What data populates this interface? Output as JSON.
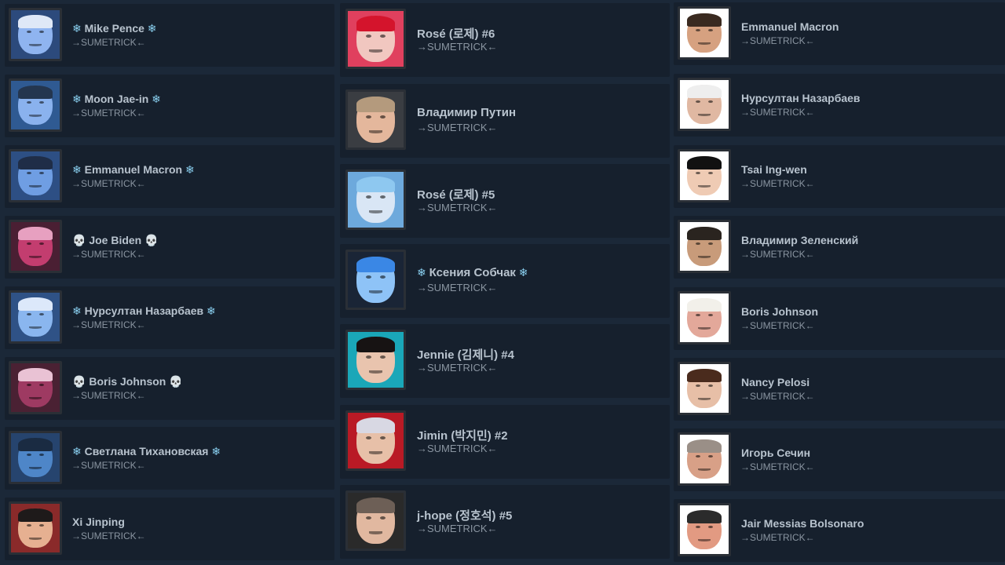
{
  "columns": [
    {
      "items": [
        {
          "name": "Mike Pence",
          "badge": "snowflake",
          "subtitle": "→SUMETRICK←",
          "skin": "#8fb4f0",
          "hair": "#dfe8f7",
          "bg": "#2c4a7c"
        },
        {
          "name": "Moon Jae-in",
          "badge": "snowflake",
          "subtitle": "→SUMETRICK←",
          "skin": "#8ab2ee",
          "hair": "#24364f",
          "bg": "#2f5a92"
        },
        {
          "name": "Emmanuel Macron",
          "badge": "snowflake",
          "subtitle": "→SUMETRICK←",
          "skin": "#6f9ee3",
          "hair": "#1f2d47",
          "bg": "#2d4f84"
        },
        {
          "name": "Joe Biden",
          "badge": "skull",
          "subtitle": "→SUMETRICK←",
          "skin": "#c33d6f",
          "hair": "#e7a0c0",
          "bg": "#4a1f33"
        },
        {
          "name": "Нурсултан Назарбаев",
          "badge": "snowflake",
          "subtitle": "→SUMETRICK←",
          "skin": "#8ab6ef",
          "hair": "#dce8fa",
          "bg": "#2f5286"
        },
        {
          "name": "Boris Johnson",
          "badge": "skull",
          "subtitle": "→SUMETRICK←",
          "skin": "#9e3a62",
          "hair": "#e9c2d4",
          "bg": "#4a2133"
        },
        {
          "name": "Светлана Тихановская",
          "badge": "snowflake",
          "subtitle": "→SUMETRICK←",
          "skin": "#4e86c8",
          "hair": "#1a2b42",
          "bg": "#26446e"
        },
        {
          "name": "Xi Jinping",
          "badge": "none",
          "subtitle": "→SUMETRICK←",
          "skin": "#e6b091",
          "hair": "#1e1a1a",
          "bg": "#8a2a2a"
        }
      ]
    },
    {
      "items": [
        {
          "name": "Rosé (로제) #6",
          "badge": "none",
          "subtitle": "→SUMETRICK←",
          "skin": "#f1c7c0",
          "hair": "#d4142c",
          "bg": "#e0405e"
        },
        {
          "name": "Владимир Путин",
          "badge": "none",
          "subtitle": "→SUMETRICK←",
          "skin": "#e4b79c",
          "hair": "#b49a7d",
          "bg": "#3a3d42"
        },
        {
          "name": "Rosé (로제) #5",
          "badge": "none",
          "subtitle": "→SUMETRICK←",
          "skin": "#d9e6f5",
          "hair": "#8ec8f0",
          "bg": "#6da9dc"
        },
        {
          "name": "Ксения Собчак",
          "badge": "snowflake",
          "subtitle": "→SUMETRICK←",
          "skin": "#8ec3f7",
          "hair": "#3a87e5",
          "bg": "#1a2536"
        },
        {
          "name": "Jennie (김제니) #4",
          "badge": "none",
          "subtitle": "→SUMETRICK←",
          "skin": "#e9c4ae",
          "hair": "#171313",
          "bg": "#1aa7b8"
        },
        {
          "name": "Jimin (박지민) #2",
          "badge": "none",
          "subtitle": "→SUMETRICK←",
          "skin": "#e7c0a8",
          "hair": "#d8d8e3",
          "bg": "#b91a25"
        },
        {
          "name": "j-hope (정호석) #5",
          "badge": "none",
          "subtitle": "→SUMETRICK←",
          "skin": "#e1b8a0",
          "hair": "#6d5f56",
          "bg": "#2a2a2a"
        }
      ]
    },
    {
      "items": [
        {
          "name": "Emmanuel Macron",
          "badge": "none",
          "subtitle": "→SUMETRICK←",
          "skin": "#d6a180",
          "hair": "#3a2a20",
          "bg": "#ffffff"
        },
        {
          "name": "Нурсултан Назарбаев",
          "badge": "none",
          "subtitle": "→SUMETRICK←",
          "skin": "#e0b8a2",
          "hair": "#eeeeee",
          "bg": "#ffffff"
        },
        {
          "name": "Tsai Ing-wen",
          "badge": "none",
          "subtitle": "→SUMETRICK←",
          "skin": "#efcbb4",
          "hair": "#111111",
          "bg": "#ffffff"
        },
        {
          "name": "Владимир Зеленский",
          "badge": "none",
          "subtitle": "→SUMETRICK←",
          "skin": "#c89b7a",
          "hair": "#2a241f",
          "bg": "#ffffff"
        },
        {
          "name": "Boris Johnson",
          "badge": "none",
          "subtitle": "→SUMETRICK←",
          "skin": "#e3a89a",
          "hair": "#f2f0ea",
          "bg": "#ffffff"
        },
        {
          "name": "Nancy Pelosi",
          "badge": "none",
          "subtitle": "→SUMETRICK←",
          "skin": "#e7bfa7",
          "hair": "#4a2b1d",
          "bg": "#ffffff"
        },
        {
          "name": "Игорь Сечин",
          "badge": "none",
          "subtitle": "→SUMETRICK←",
          "skin": "#d8a087",
          "hair": "#9a8f87",
          "bg": "#ffffff"
        },
        {
          "name": "Jair Messias Bolsonaro",
          "badge": "none",
          "subtitle": "→SUMETRICK←",
          "skin": "#e29a82",
          "hair": "#2b2b2b",
          "bg": "#ffffff"
        }
      ]
    }
  ],
  "badges": {
    "snowflake": {
      "glyph": "❄",
      "icon": "snowflake-icon",
      "color": "#8ad0f0"
    },
    "skull": {
      "glyph": "💀",
      "icon": "skull-icon",
      "color": "#e6e6e6"
    }
  },
  "colors": {
    "page_background": "#1b2838",
    "card_background": "#16202d",
    "name_text": "#b8c3ce",
    "subtitle_text": "#8a95a1"
  }
}
